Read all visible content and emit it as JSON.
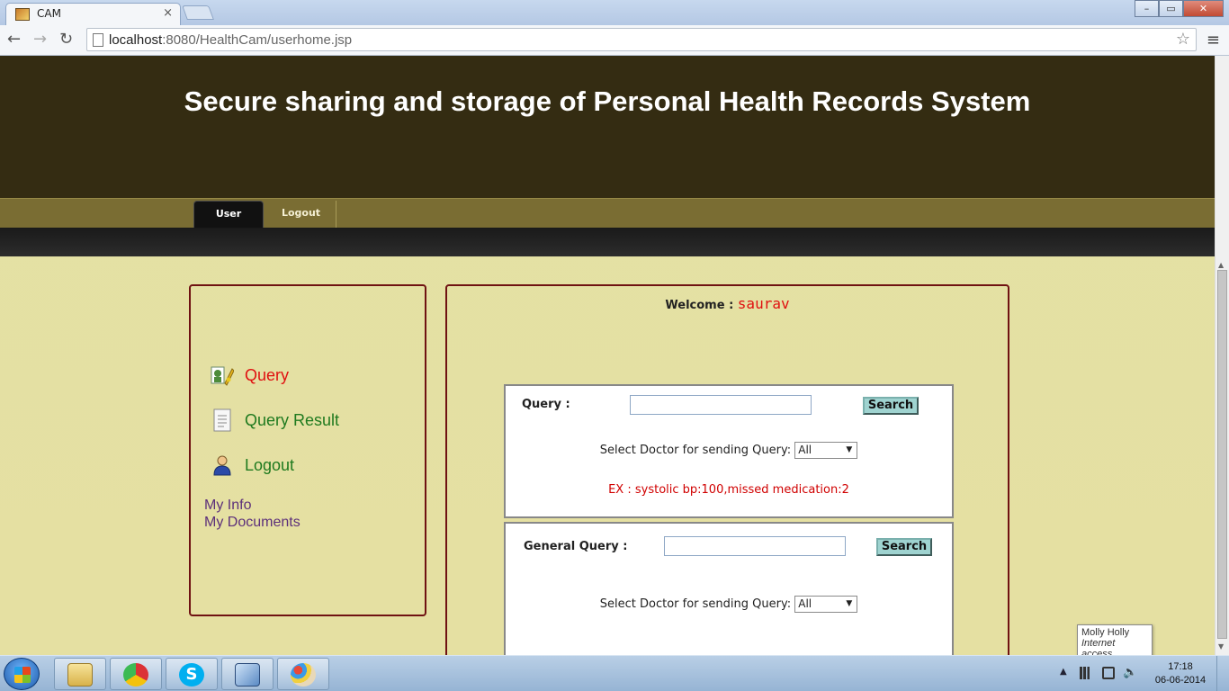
{
  "browser": {
    "tab_title": "CAM",
    "tab_close": "×",
    "url_host": "localhost",
    "url_rest": ":8080/HealthCam/userhome.jsp",
    "back_icon": "←",
    "forward_icon": "→",
    "reload_icon": "↻",
    "star_icon": "☆",
    "menu_icon": "≡",
    "min_icon": "–",
    "max_icon": "▭",
    "close_icon": "✕"
  },
  "header": {
    "title": "Secure sharing and storage of Personal Health Records System"
  },
  "nav": {
    "tabs": [
      {
        "label": "User",
        "active": true
      },
      {
        "label": "Logout",
        "active": false
      }
    ]
  },
  "sidebar": {
    "items": [
      {
        "label": "Query",
        "icon": "query-icon"
      },
      {
        "label": "Query Result",
        "icon": "document-icon"
      },
      {
        "label": "Logout",
        "icon": "user-icon"
      }
    ],
    "links": [
      "My Info",
      "My Documents"
    ]
  },
  "content": {
    "welcome_label": "Welcome :",
    "welcome_user": "saurav",
    "query_form": {
      "label": "Query :",
      "input_value": "",
      "search_label": "Search",
      "doctor_label": "Select Doctor for sending Query:",
      "doctor_selected": "All",
      "example": "EX : systolic bp:100,missed medication:2"
    },
    "general_form": {
      "label": "General Query :",
      "input_value": "",
      "search_label": "Search",
      "doctor_label": "Select Doctor for sending Query:",
      "doctor_selected": "All"
    }
  },
  "tooltip": {
    "title": "Molly Holly",
    "subtitle": "Internet access"
  },
  "taskbar": {
    "apps": [
      "file-explorer-icon",
      "chrome-icon",
      "skype-icon",
      "virtualbox-icon",
      "paint-icon"
    ],
    "tray_arrow": "▲",
    "time": "17:18",
    "date": "06-06-2014"
  },
  "colors": {
    "header_bg": "#342c12",
    "nav_bg": "#7a6d33",
    "page_bg": "#e5e0a2",
    "border_red": "#6f1212",
    "accent_red": "#e01010",
    "link_green": "#1f7a1f",
    "button_teal": "#9fd3d0"
  }
}
